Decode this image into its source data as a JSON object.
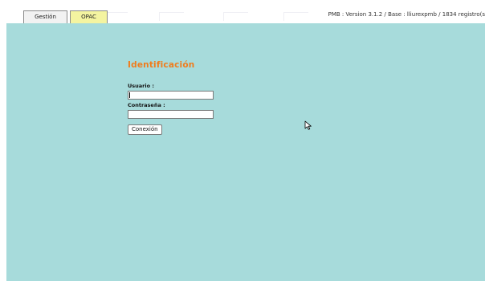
{
  "tabs": [
    {
      "label": "Gestión",
      "active": true
    },
    {
      "label": "OPAC",
      "active": false
    }
  ],
  "version_info": "PMB : Version 3.1.2 / Base : lliurexpmb / 1834 registro(s",
  "login": {
    "title": "Identificación",
    "username_label": "Usuario :",
    "username_value": "",
    "password_label": "Contraseña :",
    "password_value": "",
    "submit_label": "Conexión"
  },
  "colors": {
    "background": "#a7dbdb",
    "title": "#f07c1c",
    "tab_opac": "#f4f4a0",
    "tab_gestion": "#f2f2f2"
  }
}
